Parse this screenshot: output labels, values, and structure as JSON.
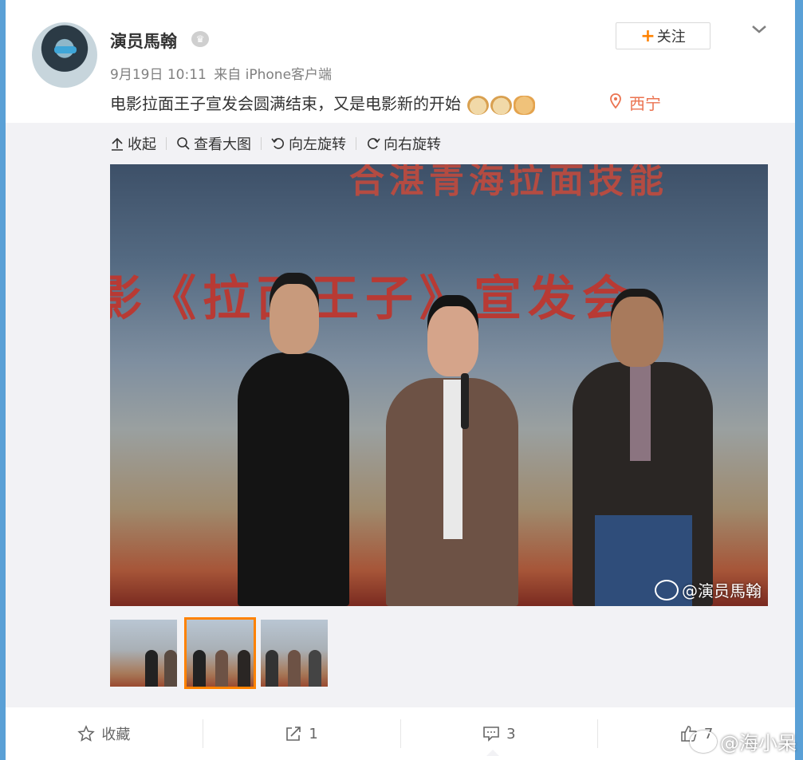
{
  "post": {
    "author": "演员馬翰",
    "time": "9月19日 10:11",
    "source": "来自 iPhone客户端",
    "text": "电影拉面王子宣发会圆满结束，又是电影新的开始",
    "location": "西宁",
    "follow_label": "关注"
  },
  "toolbar": {
    "collapse": "收起",
    "view_large": "查看大图",
    "rotate_left": "向左旋转",
    "rotate_right": "向右旋转"
  },
  "photo": {
    "banner_top": "合湛青海拉面技能",
    "banner_main": "影《拉面王子》宣发会",
    "watermark": "@演员馬翰"
  },
  "thumbnails": [
    {
      "label": "thumbnail 1",
      "active": false
    },
    {
      "label": "thumbnail 2",
      "active": true
    },
    {
      "label": "thumbnail 3",
      "active": false
    }
  ],
  "actions": {
    "favorite": "收藏",
    "repost_count": "1",
    "comment_count": "3",
    "like_count": "7"
  },
  "page_watermark": "@海小呆",
  "colors": {
    "accent_orange": "#ff8200",
    "location_red": "#eb7350",
    "page_bg": "#5aa0d6"
  },
  "icons": [
    "vip-icon",
    "chevron-down-icon",
    "plus-icon",
    "location-pin-icon",
    "collapse-icon",
    "search-icon",
    "rotate-left-icon",
    "rotate-right-icon",
    "star-icon",
    "repost-icon",
    "comment-icon",
    "like-icon",
    "weibo-logo-icon"
  ]
}
